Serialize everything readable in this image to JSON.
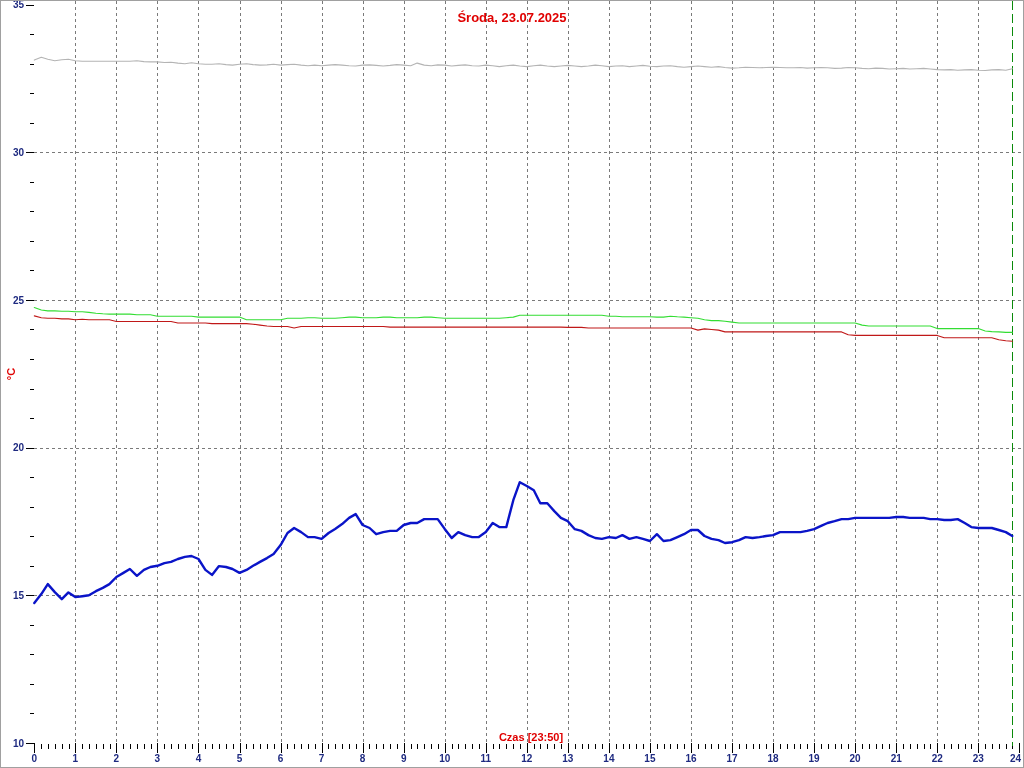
{
  "chart": {
    "chart_data": {
      "type": "line",
      "title": "Środa, 23.07.2025",
      "xlabel": "Czas [23:50]",
      "ylabel": "°C",
      "xlim": [
        0,
        24
      ],
      "ylim": [
        10,
        35
      ],
      "grid": true,
      "xticks": [
        0,
        1,
        2,
        3,
        4,
        5,
        6,
        7,
        8,
        9,
        10,
        11,
        12,
        13,
        14,
        15,
        16,
        17,
        18,
        19,
        20,
        21,
        22,
        23,
        24
      ],
      "yticks": [
        10,
        15,
        20,
        25,
        30,
        35
      ],
      "x": [
        0,
        0.17,
        0.33,
        0.5,
        0.67,
        0.83,
        1,
        1.17,
        1.33,
        1.5,
        1.67,
        1.83,
        2,
        2.17,
        2.33,
        2.5,
        2.67,
        2.83,
        3,
        3.17,
        3.33,
        3.5,
        3.67,
        3.83,
        4,
        4.17,
        4.33,
        4.5,
        4.67,
        4.83,
        5,
        5.17,
        5.33,
        5.5,
        5.67,
        5.83,
        6,
        6.17,
        6.33,
        6.5,
        6.67,
        6.83,
        7,
        7.17,
        7.33,
        7.5,
        7.67,
        7.83,
        8,
        8.17,
        8.33,
        8.5,
        8.67,
        8.83,
        9,
        9.17,
        9.33,
        9.5,
        9.67,
        9.83,
        10,
        10.17,
        10.33,
        10.5,
        10.67,
        10.83,
        11,
        11.17,
        11.33,
        11.5,
        11.67,
        11.83,
        12,
        12.17,
        12.33,
        12.5,
        12.67,
        12.83,
        13,
        13.17,
        13.33,
        13.5,
        13.67,
        13.83,
        14,
        14.17,
        14.33,
        14.5,
        14.67,
        14.83,
        15,
        15.17,
        15.33,
        15.5,
        15.67,
        15.83,
        16,
        16.17,
        16.33,
        16.5,
        16.67,
        16.83,
        17,
        17.17,
        17.33,
        17.5,
        17.67,
        17.83,
        18,
        18.17,
        18.33,
        18.5,
        18.67,
        18.83,
        19,
        19.17,
        19.33,
        19.5,
        19.67,
        19.83,
        20,
        20.17,
        20.33,
        20.5,
        20.67,
        20.83,
        21,
        21.17,
        21.33,
        21.5,
        21.67,
        21.83,
        22,
        22.17,
        22.33,
        22.5,
        22.67,
        22.83,
        23,
        23.17,
        23.33,
        23.5,
        23.67,
        23.83
      ],
      "series": [
        {
          "color": "#b4b4b4",
          "values": [
            33.12,
            33.22,
            33.15,
            33.1,
            33.13,
            33.15,
            33.1,
            33.08,
            33.08,
            33.08,
            33.08,
            33.08,
            33.08,
            33.08,
            33.08,
            33.1,
            33.07,
            33.06,
            33.06,
            33.04,
            33.05,
            33.02,
            33.0,
            33.03,
            33.0,
            32.98,
            32.98,
            33.0,
            32.97,
            32.95,
            32.98,
            33.0,
            32.97,
            32.95,
            32.96,
            32.98,
            32.95,
            32.97,
            32.98,
            32.95,
            32.93,
            32.95,
            32.93,
            32.95,
            32.97,
            32.95,
            32.93,
            32.92,
            32.95,
            32.96,
            32.94,
            32.92,
            32.94,
            32.97,
            32.95,
            32.93,
            33.02,
            32.95,
            32.93,
            32.96,
            32.95,
            32.92,
            32.94,
            32.96,
            32.93,
            32.92,
            32.95,
            32.93,
            32.9,
            32.93,
            32.95,
            32.92,
            32.9,
            32.93,
            32.95,
            32.92,
            32.9,
            32.92,
            32.94,
            32.92,
            32.9,
            32.92,
            32.95,
            32.93,
            32.9,
            32.92,
            32.93,
            32.9,
            32.92,
            32.94,
            32.91,
            32.9,
            32.92,
            32.93,
            32.9,
            32.88,
            32.9,
            32.92,
            32.9,
            32.88,
            32.9,
            32.87,
            32.85,
            32.86,
            32.88,
            32.87,
            32.86,
            32.87,
            32.88,
            32.87,
            32.86,
            32.86,
            32.87,
            32.85,
            32.86,
            32.87,
            32.86,
            32.84,
            32.85,
            32.87,
            32.86,
            32.84,
            32.83,
            32.85,
            32.84,
            32.82,
            32.83,
            32.84,
            32.82,
            32.83,
            32.84,
            32.82,
            32.8,
            32.79,
            32.8,
            32.78,
            32.79,
            32.8,
            32.78,
            32.77,
            32.79,
            32.8,
            32.78,
            32.83
          ]
        },
        {
          "color": "#33dd33",
          "values": [
            24.74,
            24.66,
            24.63,
            24.63,
            24.62,
            24.62,
            24.6,
            24.6,
            24.58,
            24.55,
            24.53,
            24.52,
            24.52,
            24.52,
            24.52,
            24.5,
            24.5,
            24.5,
            24.45,
            24.45,
            24.45,
            24.45,
            24.45,
            24.45,
            24.42,
            24.42,
            24.42,
            24.42,
            24.42,
            24.42,
            24.42,
            24.33,
            24.33,
            24.33,
            24.33,
            24.33,
            24.33,
            24.38,
            24.38,
            24.38,
            24.4,
            24.4,
            24.38,
            24.38,
            24.38,
            24.4,
            24.42,
            24.42,
            24.4,
            24.4,
            24.4,
            24.42,
            24.42,
            24.4,
            24.4,
            24.4,
            24.4,
            24.42,
            24.42,
            24.4,
            24.38,
            24.38,
            24.38,
            24.38,
            24.38,
            24.38,
            24.38,
            24.38,
            24.38,
            24.4,
            24.42,
            24.48,
            24.48,
            24.48,
            24.48,
            24.48,
            24.48,
            24.48,
            24.48,
            24.48,
            24.48,
            24.48,
            24.48,
            24.48,
            24.45,
            24.45,
            24.43,
            24.43,
            24.43,
            24.43,
            24.43,
            24.42,
            24.42,
            24.45,
            24.43,
            24.42,
            24.4,
            24.38,
            24.33,
            24.3,
            24.3,
            24.28,
            24.25,
            24.22,
            24.22,
            24.22,
            24.22,
            24.22,
            24.22,
            24.22,
            24.22,
            24.22,
            24.22,
            24.22,
            24.22,
            24.22,
            24.22,
            24.22,
            24.22,
            24.22,
            24.22,
            24.15,
            24.12,
            24.12,
            24.12,
            24.12,
            24.12,
            24.12,
            24.12,
            24.12,
            24.12,
            24.12,
            24.03,
            24.03,
            24.03,
            24.03,
            24.03,
            24.03,
            24.03,
            23.95,
            23.93,
            23.92,
            23.9,
            23.9
          ]
        },
        {
          "color": "#c01818",
          "values": [
            24.46,
            24.4,
            24.38,
            24.38,
            24.36,
            24.36,
            24.33,
            24.35,
            24.33,
            24.33,
            24.33,
            24.33,
            24.27,
            24.27,
            24.27,
            24.27,
            24.27,
            24.27,
            24.27,
            24.27,
            24.27,
            24.22,
            24.22,
            24.22,
            24.22,
            24.22,
            24.2,
            24.2,
            24.2,
            24.2,
            24.2,
            24.2,
            24.18,
            24.15,
            24.12,
            24.1,
            24.1,
            24.1,
            24.05,
            24.1,
            24.1,
            24.1,
            24.1,
            24.1,
            24.1,
            24.1,
            24.1,
            24.1,
            24.1,
            24.1,
            24.1,
            24.1,
            24.08,
            24.08,
            24.08,
            24.08,
            24.08,
            24.08,
            24.08,
            24.08,
            24.08,
            24.08,
            24.08,
            24.08,
            24.08,
            24.08,
            24.08,
            24.08,
            24.08,
            24.08,
            24.08,
            24.08,
            24.08,
            24.08,
            24.08,
            24.08,
            24.08,
            24.08,
            24.07,
            24.07,
            24.07,
            24.05,
            24.05,
            24.05,
            24.05,
            24.05,
            24.05,
            24.05,
            24.05,
            24.05,
            24.05,
            24.05,
            24.05,
            24.05,
            24.05,
            24.05,
            24.05,
            23.98,
            24.02,
            24.0,
            23.98,
            23.92,
            23.92,
            23.92,
            23.92,
            23.92,
            23.92,
            23.92,
            23.92,
            23.92,
            23.92,
            23.92,
            23.92,
            23.92,
            23.92,
            23.92,
            23.92,
            23.92,
            23.92,
            23.82,
            23.8,
            23.8,
            23.8,
            23.8,
            23.8,
            23.8,
            23.8,
            23.8,
            23.8,
            23.8,
            23.8,
            23.8,
            23.8,
            23.72,
            23.72,
            23.72,
            23.72,
            23.72,
            23.72,
            23.72,
            23.72,
            23.65,
            23.62,
            23.6
          ]
        },
        {
          "color": "#0a14c8",
          "values": [
            14.74,
            15.04,
            15.38,
            15.11,
            14.87,
            15.1,
            14.94,
            14.97,
            15.0,
            15.14,
            15.25,
            15.38,
            15.62,
            15.76,
            15.89,
            15.66,
            15.86,
            15.96,
            16.0,
            16.09,
            16.13,
            16.23,
            16.3,
            16.33,
            16.23,
            15.86,
            15.69,
            15.99,
            15.96,
            15.89,
            15.76,
            15.86,
            16.0,
            16.13,
            16.26,
            16.4,
            16.7,
            17.11,
            17.28,
            17.14,
            16.97,
            16.97,
            16.91,
            17.11,
            17.25,
            17.41,
            17.62,
            17.75,
            17.38,
            17.28,
            17.07,
            17.14,
            17.18,
            17.18,
            17.38,
            17.45,
            17.45,
            17.58,
            17.58,
            17.58,
            17.25,
            16.94,
            17.14,
            17.04,
            16.97,
            16.97,
            17.14,
            17.45,
            17.31,
            17.31,
            18.22,
            18.83,
            18.7,
            18.56,
            18.12,
            18.12,
            17.85,
            17.62,
            17.51,
            17.24,
            17.18,
            17.04,
            16.94,
            16.91,
            16.97,
            16.94,
            17.04,
            16.91,
            16.97,
            16.91,
            16.84,
            17.07,
            16.84,
            16.87,
            16.97,
            17.07,
            17.21,
            17.21,
            17.01,
            16.91,
            16.87,
            16.77,
            16.8,
            16.87,
            16.97,
            16.94,
            16.97,
            17.01,
            17.04,
            17.14,
            17.14,
            17.14,
            17.14,
            17.18,
            17.24,
            17.35,
            17.45,
            17.51,
            17.58,
            17.58,
            17.62,
            17.62,
            17.62,
            17.62,
            17.62,
            17.62,
            17.65,
            17.65,
            17.62,
            17.62,
            17.62,
            17.58,
            17.58,
            17.55,
            17.55,
            17.58,
            17.45,
            17.31,
            17.28,
            17.28,
            17.28,
            17.21,
            17.14,
            17.01
          ]
        }
      ],
      "ref_lines": [
        {
          "axis": "x",
          "value": 23.83,
          "color": "#0a8a0a"
        }
      ]
    }
  }
}
